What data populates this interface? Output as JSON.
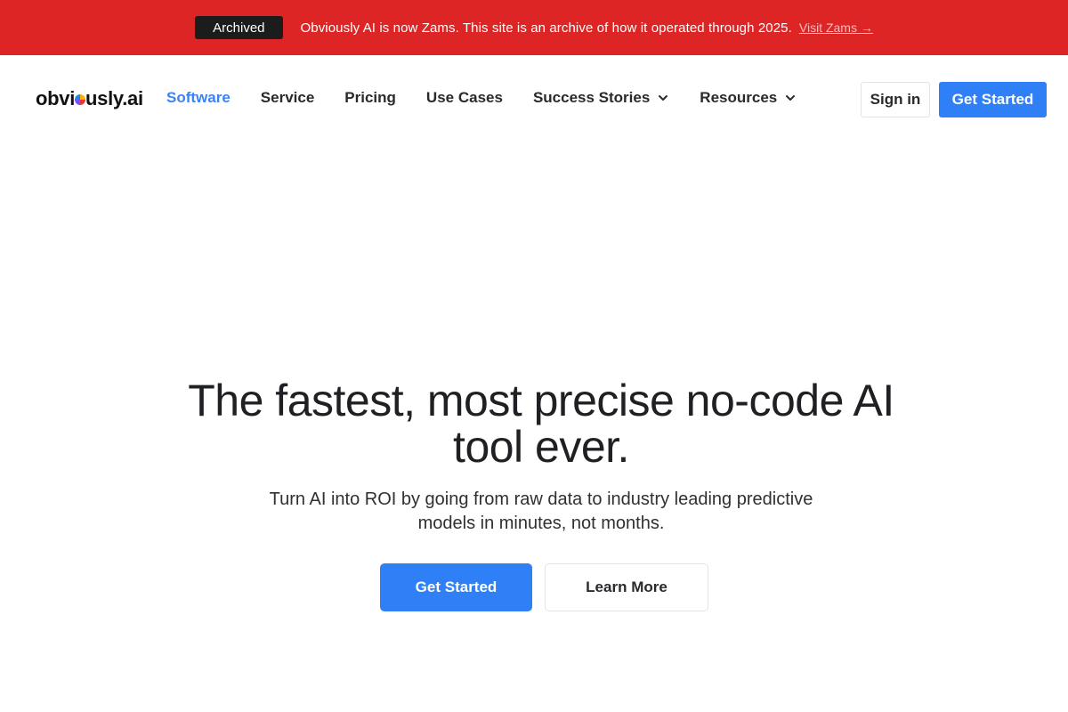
{
  "banner": {
    "badge": "Archived",
    "message": "Obviously AI is now Zams. This site is an archive of how it operated through 2025.",
    "link": "Visit Zams →",
    "color": "#dd2525"
  },
  "nav": {
    "logo_prefix": "obvi",
    "logo_suffix": "usly.ai",
    "links": [
      {
        "label": "Software",
        "active": true
      },
      {
        "label": "Service"
      },
      {
        "label": "Pricing"
      },
      {
        "label": "Use Cases"
      },
      {
        "label": "Success Stories",
        "dropdown": true
      },
      {
        "label": "Resources",
        "dropdown": true
      }
    ],
    "signin": "Sign in",
    "get_started": "Get Started",
    "accent_color": "#2f80f7"
  },
  "hero": {
    "title": "The fastest, most precise no-code AI tool ever.",
    "subtitle": "Turn AI into ROI by going from raw data to industry leading predictive models in minutes, not months.",
    "primary_button": "Get Started",
    "secondary_button": "Learn More"
  },
  "icons": {
    "logo_mark": "logo-circle-icon",
    "dropdown": "chevron-down-icon"
  }
}
